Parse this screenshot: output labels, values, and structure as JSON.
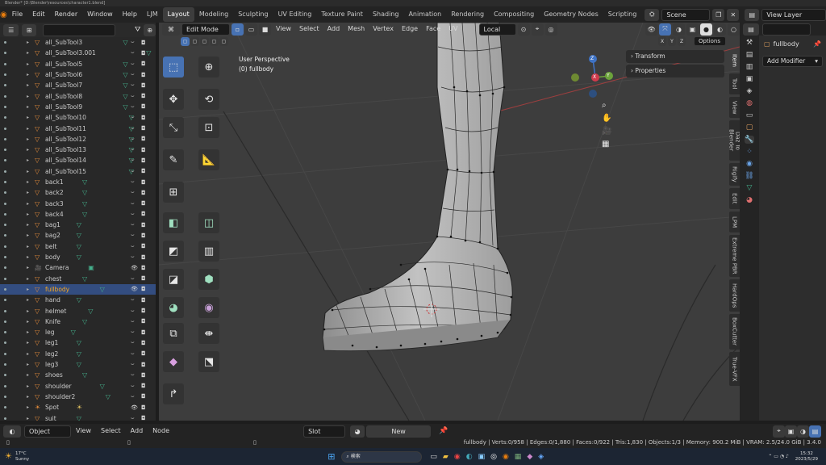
{
  "window_title": "Blender* [D:\\Blender\\resources\\character1.blend]",
  "menu": [
    "File",
    "Edit",
    "Render",
    "Window",
    "Help"
  ],
  "workspace_tabs": [
    "LJM",
    "Layout",
    "Modeling",
    "Sculpting",
    "UV Editing",
    "Texture Paint",
    "Shading",
    "Animation",
    "Rendering",
    "Compositing",
    "Geometry Nodes",
    "Scripting"
  ],
  "active_tab": "Layout",
  "scene": "Scene",
  "view_layer": "View Layer",
  "outliner": {
    "search_placeholder": "",
    "rows": [
      {
        "name": "all_SubTool3"
      },
      {
        "name": "all_SubTool3.001"
      },
      {
        "name": "all_SubTool5"
      },
      {
        "name": "all_SubTool6"
      },
      {
        "name": "all_SubTool7"
      },
      {
        "name": "all_SubTool8"
      },
      {
        "name": "all_SubTool9"
      },
      {
        "name": "all_SubTool10"
      },
      {
        "name": "all_SubTool11"
      },
      {
        "name": "all_SubTool12"
      },
      {
        "name": "all_SubTool13"
      },
      {
        "name": "all_SubTool14"
      },
      {
        "name": "all_SubTool15"
      },
      {
        "name": "back1"
      },
      {
        "name": "back2"
      },
      {
        "name": "back3"
      },
      {
        "name": "back4"
      },
      {
        "name": "bag1"
      },
      {
        "name": "bag2"
      },
      {
        "name": "belt"
      },
      {
        "name": "body"
      },
      {
        "name": "Camera",
        "type": "camera"
      },
      {
        "name": "chest"
      },
      {
        "name": "fullbody",
        "selected": true
      },
      {
        "name": "hand"
      },
      {
        "name": "helmet"
      },
      {
        "name": "Knife"
      },
      {
        "name": "leg"
      },
      {
        "name": "leg1"
      },
      {
        "name": "leg2"
      },
      {
        "name": "leg3"
      },
      {
        "name": "shoes"
      },
      {
        "name": "shoulder"
      },
      {
        "name": "shoulder2"
      },
      {
        "name": "Spot",
        "type": "light"
      },
      {
        "name": "suit"
      }
    ]
  },
  "viewport": {
    "mode": "Edit Mode",
    "menus": [
      "View",
      "Select",
      "Add",
      "Mesh",
      "Vertex",
      "Edge",
      "Face",
      "UV"
    ],
    "orientation": "Local",
    "perspective_label": "User Perspective",
    "object_label": "(0) fullbody",
    "n_panel": {
      "transform": "Transform",
      "properties": "Properties"
    },
    "options": "Options",
    "side_tabs": [
      "Item",
      "Tool",
      "View",
      "Daz To Blender",
      "Rigify",
      "Edit",
      "LPM",
      "Extreme PBR",
      "HardOps",
      "BoxCutter",
      "True-VFX"
    ],
    "axis": {
      "x": "X",
      "y": "Y",
      "z": "Z"
    }
  },
  "properties": {
    "object_name": "fullbody",
    "add_modifier": "Add Modifier"
  },
  "bottom": {
    "editor_mode": "Object",
    "menus": [
      "View",
      "Select",
      "Add",
      "Node"
    ],
    "slot": "Slot",
    "new_button": "New"
  },
  "status": "fullbody | Verts:0/958 | Edges:0/1,880 | Faces:0/922 | Tris:1,830 | Objects:1/3 | Memory: 900.2 MiB | VRAM: 2.5/24.0 GiB | 3.4.0",
  "taskbar": {
    "weather_temp": "17°C",
    "weather_text": "Sunny",
    "search": "検索",
    "time": "15:32",
    "date": "2023/5/29"
  },
  "colors": {
    "accent": "#4772b3",
    "selected_row": "#334d80",
    "mesh_icon": "#45b08c",
    "object_icon": "#e08a3b"
  }
}
